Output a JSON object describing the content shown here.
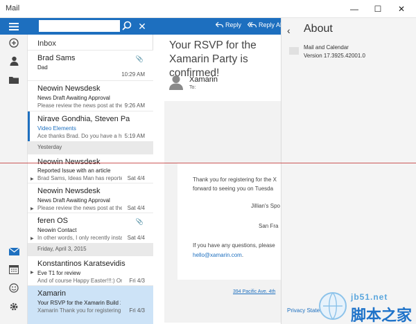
{
  "window": {
    "title": "Mail",
    "minimize": "—",
    "maximize": "☐",
    "close": "✕"
  },
  "colors": {
    "accent": "#1d6fbf",
    "selected": "#cde3f7"
  },
  "list": {
    "folder": "Inbox",
    "messages": [
      {
        "from": "Brad Sams",
        "subject": "Dad",
        "preview": "",
        "date": "10:29 AM",
        "attachment": true
      },
      {
        "from": "Neowin Newsdesk",
        "subject": "News Draft Awaiting Approval",
        "preview": "Please review the news post at the",
        "date": "9:26 AM"
      },
      {
        "from": "Nirave Gondhia, Steven Pa",
        "subject": "Video Elements",
        "preview": "Ace thanks Brad. Do you have a hig",
        "date": "5:19 AM"
      },
      {
        "from": "Neowin Newsdesk",
        "subject": "Reported Issue with an article",
        "preview": "Brad Sams, Ideas Man has reported",
        "date": "Sat 4/4"
      },
      {
        "from": "Neowin Newsdesk",
        "subject": "News Draft Awaiting Approval",
        "preview": "Please review the news post at the t",
        "date": "Sat 4/4"
      },
      {
        "from": "feren OS",
        "subject": "Neowin Contact",
        "preview": "In other words, I only recently instal",
        "date": "Sat 4/4",
        "attachment": true
      },
      {
        "from": "Konstantinos Karatsevidis",
        "subject": "Eve T1 for review",
        "preview": "And of course Happy Easter!!!:) On 4",
        "date": "Fri 4/3"
      },
      {
        "from": "Xamarin",
        "subject": "Your RSVP for the Xamarin Build 201",
        "preview": "Xamarin Thank you for registering fo",
        "date": "Fri 4/3"
      }
    ],
    "separators": [
      "Yesterday",
      "Friday, April 3, 2015"
    ]
  },
  "reading": {
    "reply": "Reply",
    "reply_all": "Reply All",
    "subject": "Your RSVP for the Xamarin Party is confirmed!",
    "sender": "Xamarin",
    "to": "To:",
    "body": {
      "line1": "Thank you for registering for the X",
      "line2": "forward to seeing you on Tuesda",
      "line3": "Jillian's Spo",
      "line4": "San Fra",
      "line5": "If you have any questions, please",
      "email": "hello@xamarin.com",
      "email_tail": ".",
      "address": "394 Pacific Ave. 4th"
    }
  },
  "about": {
    "title": "About",
    "app_name": "Mail and Calendar",
    "version": "Version 17.3925.42001.0",
    "privacy": "Privacy Statem"
  },
  "watermark": {
    "line1": "jb51.net",
    "line2": "脚本之家"
  }
}
